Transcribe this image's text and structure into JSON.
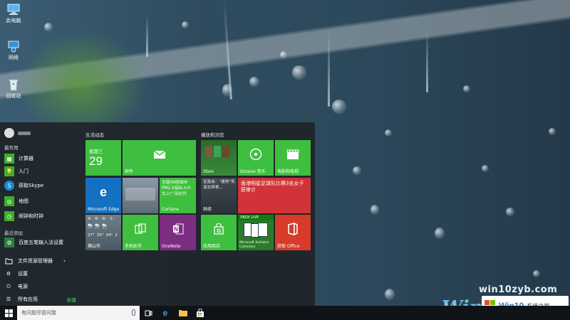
{
  "desktop": {
    "icons": [
      {
        "label": "此电脑",
        "icon": "computer-icon"
      },
      {
        "label": "网络",
        "icon": "network-icon"
      },
      {
        "label": "回收站",
        "icon": "recycle-bin-icon"
      }
    ]
  },
  "start_menu": {
    "most_used_title": "最常用",
    "most_used": [
      {
        "label": "计算器",
        "icon": "calculator-icon",
        "color": "#3fae2a"
      },
      {
        "label": "入门",
        "icon": "lightbulb-icon",
        "color": "#3fae2a"
      },
      {
        "label": "获取Skype",
        "icon": "skype-icon",
        "color": "#1a8ad4"
      },
      {
        "label": "地图",
        "icon": "map-icon",
        "color": "#3fae2a"
      },
      {
        "label": "闹钟和时钟",
        "icon": "alarm-icon",
        "color": "#3fae2a"
      }
    ],
    "recently_added_title": "最近添加",
    "recently_added": [
      {
        "label": "百度五笔输入法设置",
        "icon": "baidu-input-icon",
        "color": "#2d7f3e"
      }
    ],
    "system": [
      {
        "label": "文件资源管理器",
        "icon": "folder-icon"
      },
      {
        "label": "设置",
        "icon": "gear-icon"
      },
      {
        "label": "电源",
        "icon": "power-icon"
      },
      {
        "label": "所有应用",
        "icon": "list-icon"
      }
    ],
    "new_badge": "新建",
    "groups": {
      "life_title": "生活动态",
      "play_title": "播放和浏览"
    },
    "tiles": {
      "calendar_day": "星期三",
      "calendar_date": "29",
      "mail": "邮件",
      "edge": "Microsoft Edge",
      "cortana_text": "全国49座城市PM2.5指标上升 北上广深在列",
      "cortana": "Cortana",
      "weather_times": [
        "4:",
        "6:",
        "8:",
        "1:"
      ],
      "weather_temps": [
        "27°",
        "25°",
        "24°",
        "2"
      ],
      "weather_city": "佛山市",
      "phone": "手机助手",
      "onenote": "OneNote",
      "xbox": "Xbox",
      "groove": "Groove 音乐",
      "movies": "电影和电视",
      "finance_text": "证监会：“迷你”队 深交所将...",
      "finance": "财经",
      "sports_text": "香港明星足球队比赛3名女子 获审计",
      "store": "应用商店",
      "solitaire_badge": "XBOX LIVE",
      "solitaire": "Microsoft Solitaire Collection",
      "office": "获取 Office"
    },
    "colors": {
      "green": "#3fbf3f",
      "purple": "#7b2d82",
      "red": "#d83b2a",
      "blue": "#1470c0",
      "news_red": "#d13438"
    }
  },
  "taskbar": {
    "search_placeholder": "有问题尽管问我"
  },
  "watermark": {
    "url": "win10zyb.com",
    "logo_text": "Win",
    "badge_brand": "Win10",
    "badge_text": "系统之家"
  }
}
